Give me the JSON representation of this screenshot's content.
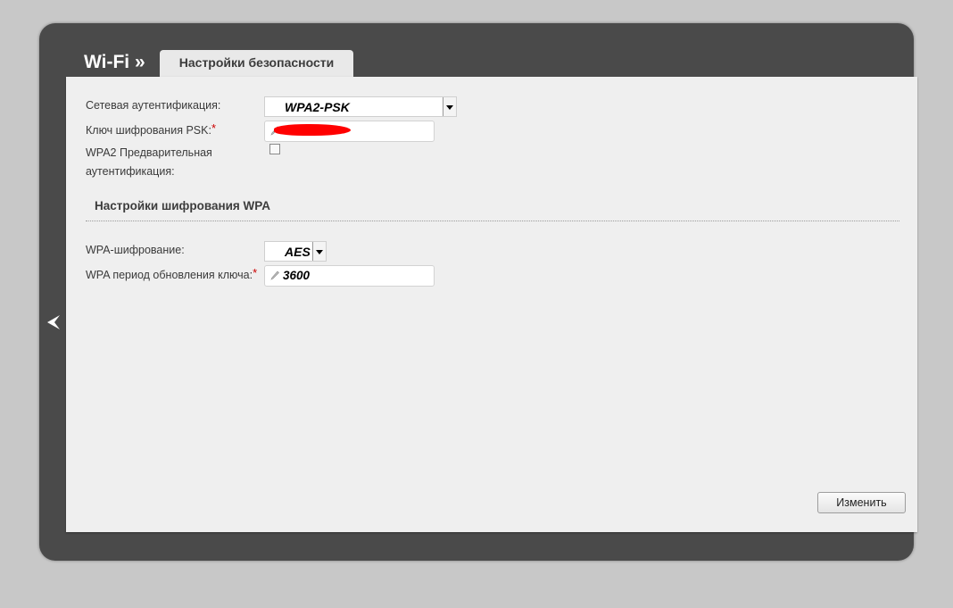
{
  "header": {
    "title": "Wi-Fi »"
  },
  "tabs": [
    {
      "label": "Настройки безопасности"
    }
  ],
  "form": {
    "auth_label": "Сетевая аутентификация:",
    "auth_value": "WPA2-PSK",
    "psk_label": "Ключ шифрования PSK:",
    "psk_required": "*",
    "preauth_label_line1": "WPA2 Предварительная",
    "preauth_label_line2": "аутентификация:",
    "preauth_checked": false
  },
  "wpa_section": {
    "title": "Настройки шифрования WPA",
    "enc_label": "WPA-шифрование:",
    "enc_value": "AES",
    "rekey_label": "WPA период обновления ключа:",
    "rekey_required": "*",
    "rekey_value": "3600"
  },
  "actions": {
    "change_label": "Изменить"
  },
  "icons": {
    "back": "chevron-left-icon",
    "pencil": "pencil-icon",
    "dropdown": "chevron-down-icon"
  },
  "colors": {
    "frame": "#4a4a4a",
    "panel": "#efefef",
    "required": "#cc0000",
    "redaction": "#ff0000"
  }
}
